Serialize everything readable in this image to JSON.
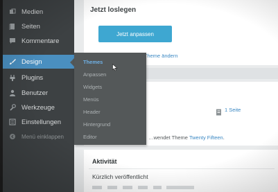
{
  "sidebar": {
    "items": [
      {
        "label": "Medien",
        "icon": "media-icon"
      },
      {
        "label": "Seiten",
        "icon": "pages-icon"
      },
      {
        "label": "Kommentare",
        "icon": "comments-icon"
      },
      {
        "label": "Design",
        "icon": "brush-icon"
      },
      {
        "label": "Plugins",
        "icon": "plugin-icon"
      },
      {
        "label": "Benutzer",
        "icon": "user-icon"
      },
      {
        "label": "Werkzeuge",
        "icon": "wrench-icon"
      },
      {
        "label": "Einstellungen",
        "icon": "settings-icon"
      },
      {
        "label": "Menü einklappen",
        "icon": "collapse-icon"
      }
    ]
  },
  "submenu": {
    "items": [
      "Themes",
      "Anpassen",
      "Widgets",
      "Menüs",
      "Header",
      "Hintergrund",
      "Editor"
    ]
  },
  "welcome": {
    "heading": "Jetzt loslegen",
    "button": "Jetzt anpassen",
    "link": "oder das komplette Theme ändern"
  },
  "overview": {
    "pages": "1 Seite",
    "theme_prefix": "…wendet Theme ",
    "theme_name": "Twenty Fifteen",
    "theme_suffix": "."
  },
  "activity": {
    "heading": "Aktivität",
    "recent": "Kürzlich veröffentlicht"
  },
  "colors": {
    "sidebar": "#3d4143",
    "active": "#4a8fc0",
    "flyout": "#545859",
    "button": "#3ea7d1",
    "link": "#3b88c3"
  }
}
